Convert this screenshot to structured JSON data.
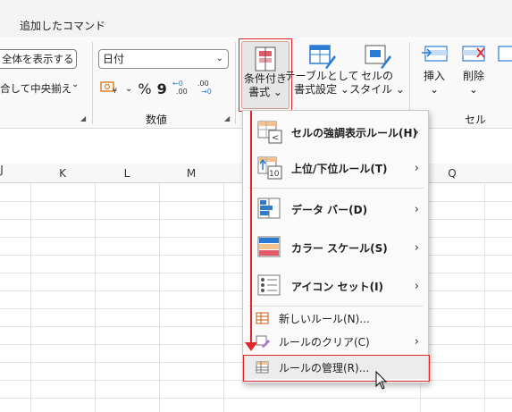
{
  "ribbon": {
    "tab_label": "追加したコマンド",
    "show_all_label": "全体を表示する",
    "merge_label": "合して中央揃え",
    "number_format": "日付",
    "number_group_label": "数値",
    "percent_symbol": "%",
    "comma_symbol": "9",
    "cond_format_label_1": "条件付き",
    "cond_format_label_2": "書式 ⌄",
    "table_format_label_1": "テーブルとして",
    "table_format_label_2": "書式設定 ⌄",
    "cell_style_label_1": "セルの",
    "cell_style_label_2": "スタイル ⌄",
    "insert_label": "挿入",
    "delete_label": "削除",
    "cells_group_label": "セル"
  },
  "grid": {
    "columns": [
      "K",
      "L",
      "M",
      "Q"
    ],
    "partial_column": "J"
  },
  "menu": {
    "items": [
      {
        "label": "セルの強調表示ルール(H)",
        "submenu": true
      },
      {
        "label": "上位/下位ルール(T)",
        "submenu": true
      },
      {
        "label": "データ バー(D)",
        "submenu": true
      },
      {
        "label": "カラー スケール(S)",
        "submenu": true
      },
      {
        "label": "アイコン セット(I)",
        "submenu": true
      },
      {
        "label": "新しいルール(N)...",
        "submenu": false
      },
      {
        "label": "ルールのクリア(C)",
        "submenu": true
      },
      {
        "label": "ルールの管理(R)...",
        "submenu": false
      }
    ],
    "icon_10_text": "10",
    "icon_lt_text": "<"
  },
  "colors": {
    "accent_red": "#e0262b",
    "excel_blue": "#2b7bd3",
    "excel_red": "#e35a6a"
  }
}
